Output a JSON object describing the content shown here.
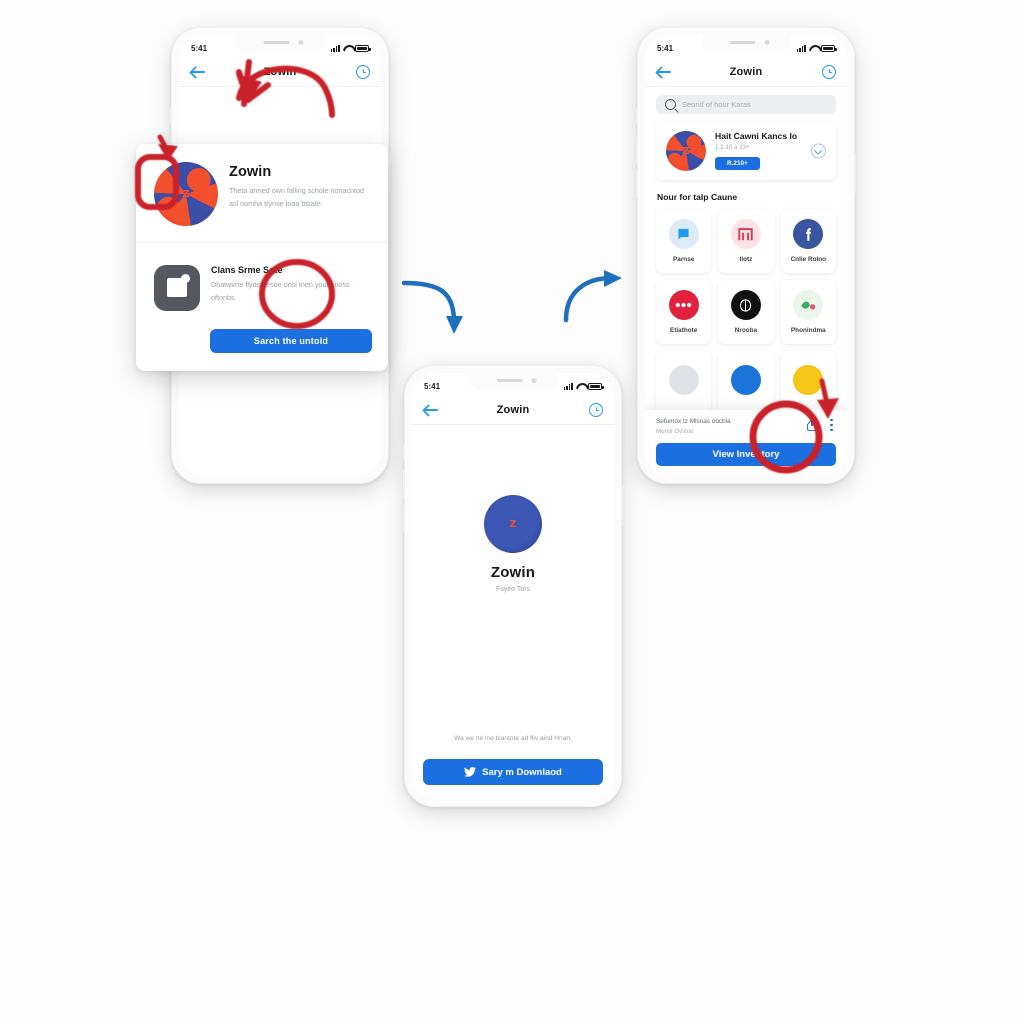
{
  "canvas": {
    "background_color": "#fdfdfd",
    "accent_blue": "#1b6fe0",
    "twitter_blue": "#1d9bf0",
    "annotation_red": "#c9202a",
    "flow_arrow_blue": "#1f6fbf"
  },
  "phone_left": {
    "status": {
      "time": "5:41"
    },
    "nav": {
      "back_icon": "back-arrow-icon",
      "title": "Zowin",
      "right_icon": "info-circle-icon"
    },
    "sheet": {
      "app_row": {
        "logo": "zowin-logo",
        "title": "Zowin",
        "description": "Theta armed own falling schole nonacntod asl nomha trynse loaa bstate."
      },
      "action_row": {
        "icon": "save-document-icon",
        "title": "Clans Srme Sote",
        "description": "Dhatwvrte flyost fesoe onsl tnen your snoss oftonbs"
      },
      "cta_label": "Sarch the untold"
    }
  },
  "phone_mid": {
    "status": {
      "time": "5:41"
    },
    "nav": {
      "back_icon": "back-arrow-icon",
      "title": "Zowin",
      "right_icon": "history-clock-icon"
    },
    "app": {
      "logo": "zowin-logo",
      "name": "Zowin",
      "tagline": "Fsyeo Tors"
    },
    "footer_note": "Wa we ne lne biantote ad fliv aind Hnan.",
    "cta": {
      "icon": "twitter-bird-icon",
      "label": "Sary m Downlaod"
    }
  },
  "phone_right": {
    "status": {
      "time": "5:41"
    },
    "nav": {
      "back_icon": "back-arrow-icon",
      "title": "Zowin",
      "right_icon": "clock-circle-icon"
    },
    "search": {
      "icon": "search-icon",
      "placeholder": "Seond of hour Karas"
    },
    "promo": {
      "logo": "zowin-logo",
      "title": "Hait Cawni Kancs lo",
      "meta": "1.2.10.a  23+",
      "button_label": "R.210+",
      "side_icon": "chevron-circle-icon"
    },
    "section_title": "Nour for talp Caune",
    "tiles": [
      {
        "label": "Parnse",
        "icon": "blue-chat-icon",
        "icon_bg": "#ddeaf8",
        "icon_fg": "#1d9bf0"
      },
      {
        "label": "Ilotz",
        "icon": "red-gate-icon",
        "icon_bg": "#fbe3e6",
        "icon_fg": "#e0394f"
      },
      {
        "label": "Cnlie Rolno",
        "icon": "facebook-f-icon",
        "icon_bg": "#3a559f",
        "icon_fg": "#ffffff"
      },
      {
        "label": "Etiathote",
        "icon": "red-dots-icon",
        "icon_bg": "#e0203c",
        "icon_fg": "#ffffff"
      },
      {
        "label": "Nrooba",
        "icon": "black-arc-icon",
        "icon_bg": "#111111",
        "icon_fg": "#ffffff"
      },
      {
        "label": "Phonindma",
        "icon": "green-pink-leaf-icon",
        "icon_bg": "#eaf6ec",
        "icon_fg": "#3fae62"
      },
      {
        "label": "",
        "icon": "grey-circle-icon",
        "icon_bg": "#dfe3e8",
        "icon_fg": "#dfe3e8"
      },
      {
        "label": "",
        "icon": "blue-circle-icon",
        "icon_bg": "#1b74d8",
        "icon_fg": "#1b74d8"
      },
      {
        "label": "",
        "icon": "yellow-circle-icon",
        "icon_bg": "#f5c518",
        "icon_fg": "#f5c518"
      }
    ],
    "bottom_bar": {
      "line1": "Sefumox tz Mlsnas oocbla",
      "line2": "Monsl Gvsloo",
      "share_icon": "share-icon",
      "more_icon": "more-dots-icon",
      "cta_label": "View Inventory"
    }
  },
  "annotations": {
    "red_arc_arrow_title": "red-curved-arrow-over-title",
    "red_down_arrow_logo": "red-down-arrow-to-logo",
    "red_rect_logo": "red-rounded-rect-highlight",
    "red_ellipse_action": "red-ellipse-highlight",
    "red_circle_cta": "red-circle-highlight",
    "red_down_arrow_cta": "red-down-arrow-to-cta",
    "flow_arrow_1": "blue-flow-arrow-down-right",
    "flow_arrow_2": "blue-flow-arrow-up-right"
  }
}
